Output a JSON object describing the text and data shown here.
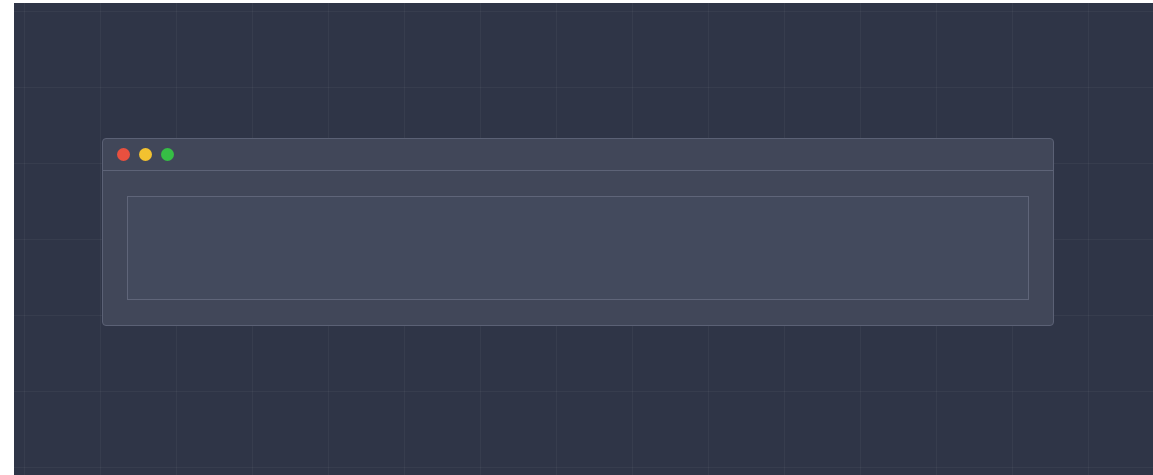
{
  "window": {
    "controls": [
      {
        "color": "#e8503f"
      },
      {
        "color": "#f2c230"
      },
      {
        "color": "#36be45"
      }
    ]
  }
}
